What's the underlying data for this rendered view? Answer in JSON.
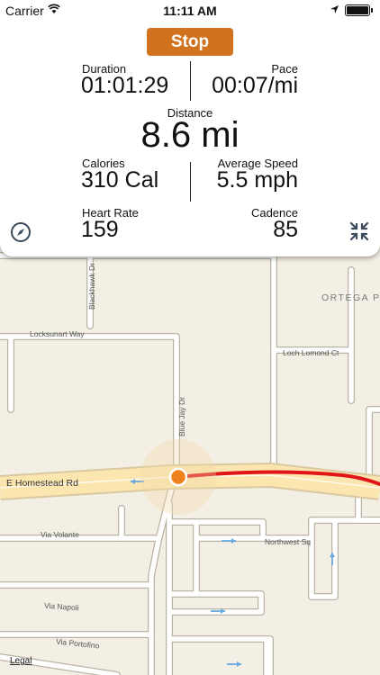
{
  "status_bar": {
    "carrier": "Carrier",
    "time": "11:11 AM"
  },
  "stats": {
    "stop_label": "Stop",
    "duration_label": "Duration",
    "duration_value": "01:01:29",
    "pace_label": "Pace",
    "pace_value": "00:07/mi",
    "distance_label": "Distance",
    "distance_value": "8.6 mi",
    "calories_label": "Calories",
    "calories_value": "310 Cal",
    "avg_speed_label": "Average Speed",
    "avg_speed_value": "5.5 mph",
    "heart_rate_label": "Heart Rate",
    "heart_rate_value": "159",
    "cadence_label": "Cadence",
    "cadence_value": "85"
  },
  "map": {
    "labels": {
      "ortega_park": "ORTEGA PA",
      "locksunart_way": "Locksunart Way",
      "loch_lomond_ct": "Loch Lomond Ct",
      "blackhawk_dr": "Blackhawk Dr",
      "blue_jay_dr": "Blue Jay Dr",
      "e_homestead_rd": "E Homestead Rd",
      "via_volante": "Via Volante",
      "northwest_sq": "Northwest Sq",
      "via_napoli": "Via Napoli",
      "via_portofino": "Via Portofino",
      "legal": "Legal"
    },
    "colors": {
      "route": "#e01515",
      "position_dot": "#f0821e",
      "highway": "#fbe6b0"
    }
  },
  "icons": {
    "compass": "compass-icon",
    "collapse": "collapse-icon",
    "location": "location-arrow-icon",
    "wifi": "wifi-icon",
    "battery": "battery-icon"
  }
}
